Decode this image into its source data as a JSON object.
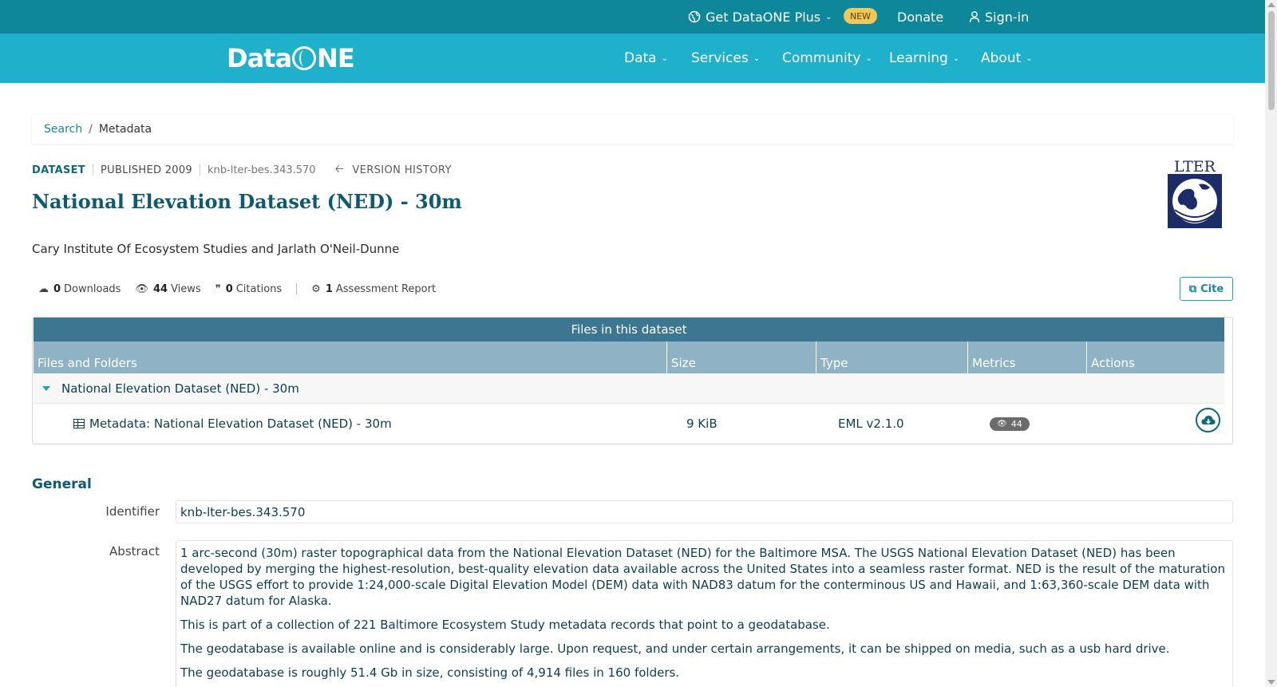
{
  "topbar": {
    "plus_label": "Get DataONE Plus",
    "new_badge": "NEW",
    "donate_label": "Donate",
    "signin_label": "Sign-in"
  },
  "header": {
    "logo_text_a": "Data",
    "logo_text_b": "NE",
    "nav": [
      {
        "label": "Data"
      },
      {
        "label": "Services"
      },
      {
        "label": "Community"
      },
      {
        "label": "Learning"
      },
      {
        "label": "About"
      }
    ]
  },
  "breadcrumb": {
    "search": "Search",
    "separator": "/",
    "current": "Metadata"
  },
  "dataset": {
    "type_label": "DATASET",
    "published": "PUBLISHED 2009",
    "pid": "knb-lter-bes.343.570",
    "version_history": "VERSION HISTORY",
    "title": "National Elevation Dataset (NED) - 30m",
    "authors": "Cary Institute Of Ecosystem Studies and Jarlath O'Neil-Dunne",
    "logo_text": "LTER"
  },
  "stats": {
    "downloads_count": "0",
    "downloads_label": "Downloads",
    "views_count": "44",
    "views_label": "Views",
    "citations_count": "0",
    "citations_label": "Citations",
    "assessment_count": "1",
    "assessment_label": "Assessment Report",
    "cite_label": "Cite"
  },
  "files": {
    "header": "Files in this dataset",
    "columns": [
      "Files and Folders",
      "Size",
      "Type",
      "Metrics",
      "Actions"
    ],
    "folder_name": "National Elevation Dataset (NED) - 30m",
    "file": {
      "name": "Metadata: National Elevation Dataset (NED) - 30m",
      "size": "9 KiB",
      "type": "EML v2.1.0",
      "views": "44"
    }
  },
  "general": {
    "heading": "General",
    "identifier_label": "Identifier",
    "identifier_value": "knb-lter-bes.343.570",
    "abstract_label": "Abstract",
    "abstract_paragraphs": [
      "1 arc-second (30m) raster topographical data from the National Elevation Dataset (NED) for the Baltimore MSA. The USGS National Elevation Dataset (NED) has been developed by merging the highest-resolution, best-quality elevation data available across the United States into a seamless raster format. NED is the result of the maturation of the USGS effort to provide 1:24,000-scale Digital Elevation Model (DEM) data with NAD83 datum for the conterminous US and Hawaii, and 1:63,360-scale DEM data with NAD27 datum for Alaska.",
      "This is part of a collection of 221 Baltimore Ecosystem Study metadata records that point to a geodatabase.",
      "The geodatabase is available online and is considerably large. Upon request, and under certain arrangements, it can be shipped on media, such as a usb hard drive.",
      "The geodatabase is roughly 51.4 Gb in size, consisting of 4,914 files in 160 folders."
    ]
  },
  "colors": {
    "topbar": "#0e879b",
    "header": "#1fb0cb",
    "title": "#0c5a75",
    "table_header": "#3d7690",
    "table_columns": "#8fb3c4",
    "badge_new": "#f0c85a"
  }
}
